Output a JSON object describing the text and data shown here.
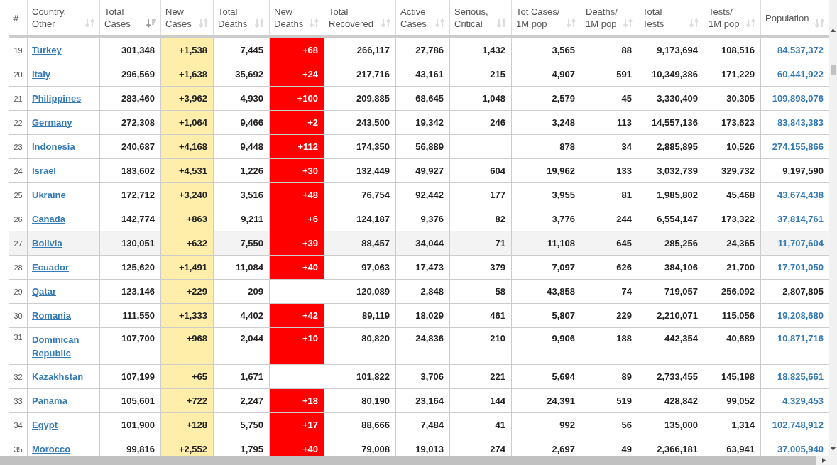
{
  "columns": [
    {
      "label": "#"
    },
    {
      "label": "Country,\nOther",
      "sorted": false
    },
    {
      "label": "Total\nCases",
      "sorted": true
    },
    {
      "label": "New\nCases",
      "sorted": false
    },
    {
      "label": "Total\nDeaths",
      "sorted": false
    },
    {
      "label": "New\nDeaths",
      "sorted": false
    },
    {
      "label": "Total\nRecovered",
      "sorted": false
    },
    {
      "label": "Active\nCases",
      "sorted": false
    },
    {
      "label": "Serious,\nCritical",
      "sorted": false
    },
    {
      "label": "Tot Cases/\n1M pop",
      "sorted": false
    },
    {
      "label": "Deaths/\n1M pop",
      "sorted": false
    },
    {
      "label": "Total\nTests",
      "sorted": false
    },
    {
      "label": "Tests/\n1M pop",
      "sorted": false
    },
    {
      "label": "Population",
      "sorted": false
    }
  ],
  "rows": [
    {
      "rank": "19",
      "country": "Turkey",
      "total_cases": "301,348",
      "new_cases": "+1,538",
      "total_deaths": "7,445",
      "new_deaths": "+68",
      "total_recovered": "266,117",
      "active_cases": "27,786",
      "serious_critical": "1,432",
      "cases_per_1m": "3,565",
      "deaths_per_1m": "88",
      "total_tests": "9,173,694",
      "tests_per_1m": "108,516",
      "population": "84,537,372",
      "population_linked": true,
      "highlighted": false
    },
    {
      "rank": "20",
      "country": "Italy",
      "total_cases": "296,569",
      "new_cases": "+1,638",
      "total_deaths": "35,692",
      "new_deaths": "+24",
      "total_recovered": "217,716",
      "active_cases": "43,161",
      "serious_critical": "215",
      "cases_per_1m": "4,907",
      "deaths_per_1m": "591",
      "total_tests": "10,349,386",
      "tests_per_1m": "171,229",
      "population": "60,441,922",
      "population_linked": true,
      "highlighted": false
    },
    {
      "rank": "21",
      "country": "Philippines",
      "total_cases": "283,460",
      "new_cases": "+3,962",
      "total_deaths": "4,930",
      "new_deaths": "+100",
      "total_recovered": "209,885",
      "active_cases": "68,645",
      "serious_critical": "1,048",
      "cases_per_1m": "2,579",
      "deaths_per_1m": "45",
      "total_tests": "3,330,409",
      "tests_per_1m": "30,305",
      "population": "109,898,076",
      "population_linked": true,
      "highlighted": false
    },
    {
      "rank": "22",
      "country": "Germany",
      "total_cases": "272,308",
      "new_cases": "+1,064",
      "total_deaths": "9,466",
      "new_deaths": "+2",
      "total_recovered": "243,500",
      "active_cases": "19,342",
      "serious_critical": "246",
      "cases_per_1m": "3,248",
      "deaths_per_1m": "113",
      "total_tests": "14,557,136",
      "tests_per_1m": "173,623",
      "population": "83,843,383",
      "population_linked": true,
      "highlighted": false
    },
    {
      "rank": "23",
      "country": "Indonesia",
      "total_cases": "240,687",
      "new_cases": "+4,168",
      "total_deaths": "9,448",
      "new_deaths": "+112",
      "total_recovered": "174,350",
      "active_cases": "56,889",
      "cases_per_1m": "878",
      "deaths_per_1m": "34",
      "total_tests": "2,885,895",
      "tests_per_1m": "10,526",
      "population": "274,155,866",
      "population_linked": true,
      "highlighted": false
    },
    {
      "rank": "24",
      "country": "Israel",
      "total_cases": "183,602",
      "new_cases": "+4,531",
      "total_deaths": "1,226",
      "new_deaths": "+30",
      "total_recovered": "132,449",
      "active_cases": "49,927",
      "serious_critical": "604",
      "cases_per_1m": "19,962",
      "deaths_per_1m": "133",
      "total_tests": "3,032,739",
      "tests_per_1m": "329,732",
      "population": "9,197,590",
      "population_linked": false,
      "highlighted": false
    },
    {
      "rank": "25",
      "country": "Ukraine",
      "total_cases": "172,712",
      "new_cases": "+3,240",
      "total_deaths": "3,516",
      "new_deaths": "+48",
      "total_recovered": "76,754",
      "active_cases": "92,442",
      "serious_critical": "177",
      "cases_per_1m": "3,955",
      "deaths_per_1m": "81",
      "total_tests": "1,985,802",
      "tests_per_1m": "45,468",
      "population": "43,674,438",
      "population_linked": true,
      "highlighted": false
    },
    {
      "rank": "26",
      "country": "Canada",
      "total_cases": "142,774",
      "new_cases": "+863",
      "total_deaths": "9,211",
      "new_deaths": "+6",
      "total_recovered": "124,187",
      "active_cases": "9,376",
      "serious_critical": "82",
      "cases_per_1m": "3,776",
      "deaths_per_1m": "244",
      "total_tests": "6,554,147",
      "tests_per_1m": "173,322",
      "population": "37,814,761",
      "population_linked": true,
      "highlighted": false
    },
    {
      "rank": "27",
      "country": "Bolivia",
      "total_cases": "130,051",
      "new_cases": "+632",
      "total_deaths": "7,550",
      "new_deaths": "+39",
      "total_recovered": "88,457",
      "active_cases": "34,044",
      "serious_critical": "71",
      "cases_per_1m": "11,108",
      "deaths_per_1m": "645",
      "total_tests": "285,256",
      "tests_per_1m": "24,365",
      "population": "11,707,604",
      "population_linked": true,
      "highlighted": true
    },
    {
      "rank": "28",
      "country": "Ecuador",
      "total_cases": "125,620",
      "new_cases": "+1,491",
      "total_deaths": "11,084",
      "new_deaths": "+40",
      "total_recovered": "97,063",
      "active_cases": "17,473",
      "serious_critical": "379",
      "cases_per_1m": "7,097",
      "deaths_per_1m": "626",
      "total_tests": "384,106",
      "tests_per_1m": "21,700",
      "population": "17,701,050",
      "population_linked": true,
      "highlighted": false
    },
    {
      "rank": "29",
      "country": "Qatar",
      "total_cases": "123,146",
      "new_cases": "+229",
      "total_deaths": "209",
      "total_recovered": "120,089",
      "active_cases": "2,848",
      "serious_critical": "58",
      "cases_per_1m": "43,858",
      "deaths_per_1m": "74",
      "total_tests": "719,057",
      "tests_per_1m": "256,092",
      "population": "2,807,805",
      "population_linked": false,
      "highlighted": false
    },
    {
      "rank": "30",
      "country": "Romania",
      "total_cases": "111,550",
      "new_cases": "+1,333",
      "total_deaths": "4,402",
      "new_deaths": "+42",
      "total_recovered": "89,119",
      "active_cases": "18,029",
      "serious_critical": "461",
      "cases_per_1m": "5,807",
      "deaths_per_1m": "229",
      "total_tests": "2,210,071",
      "tests_per_1m": "115,056",
      "population": "19,208,680",
      "population_linked": true,
      "highlighted": false
    },
    {
      "rank": "31",
      "country": "Dominican Republic",
      "total_cases": "107,700",
      "new_cases": "+968",
      "total_deaths": "2,044",
      "new_deaths": "+10",
      "total_recovered": "80,820",
      "active_cases": "24,836",
      "serious_critical": "210",
      "cases_per_1m": "9,906",
      "deaths_per_1m": "188",
      "total_tests": "442,354",
      "tests_per_1m": "40,689",
      "population": "10,871,716",
      "population_linked": true,
      "highlighted": false
    },
    {
      "rank": "32",
      "country": "Kazakhstan",
      "total_cases": "107,199",
      "new_cases": "+65",
      "total_deaths": "1,671",
      "total_recovered": "101,822",
      "active_cases": "3,706",
      "serious_critical": "221",
      "cases_per_1m": "5,694",
      "deaths_per_1m": "89",
      "total_tests": "2,733,455",
      "tests_per_1m": "145,198",
      "population": "18,825,661",
      "population_linked": true,
      "highlighted": false
    },
    {
      "rank": "33",
      "country": "Panama",
      "total_cases": "105,601",
      "new_cases": "+722",
      "total_deaths": "2,247",
      "new_deaths": "+18",
      "total_recovered": "80,190",
      "active_cases": "23,164",
      "serious_critical": "144",
      "cases_per_1m": "24,391",
      "deaths_per_1m": "519",
      "total_tests": "428,842",
      "tests_per_1m": "99,052",
      "population": "4,329,453",
      "population_linked": true,
      "highlighted": false
    },
    {
      "rank": "34",
      "country": "Egypt",
      "total_cases": "101,900",
      "new_cases": "+128",
      "total_deaths": "5,750",
      "new_deaths": "+17",
      "total_recovered": "88,666",
      "active_cases": "7,484",
      "serious_critical": "41",
      "cases_per_1m": "992",
      "deaths_per_1m": "56",
      "total_tests": "135,000",
      "tests_per_1m": "1,314",
      "population": "102,748,912",
      "population_linked": true,
      "highlighted": false
    },
    {
      "rank": "35",
      "country": "Morocco",
      "total_cases": "99,816",
      "new_cases": "+2,552",
      "total_deaths": "1,795",
      "new_deaths": "+40",
      "total_recovered": "79,008",
      "active_cases": "19,013",
      "serious_critical": "274",
      "cases_per_1m": "2,697",
      "deaths_per_1m": "49",
      "total_tests": "2,366,181",
      "tests_per_1m": "63,941",
      "population": "37,005,940",
      "population_linked": true,
      "highlighted": false
    }
  ]
}
